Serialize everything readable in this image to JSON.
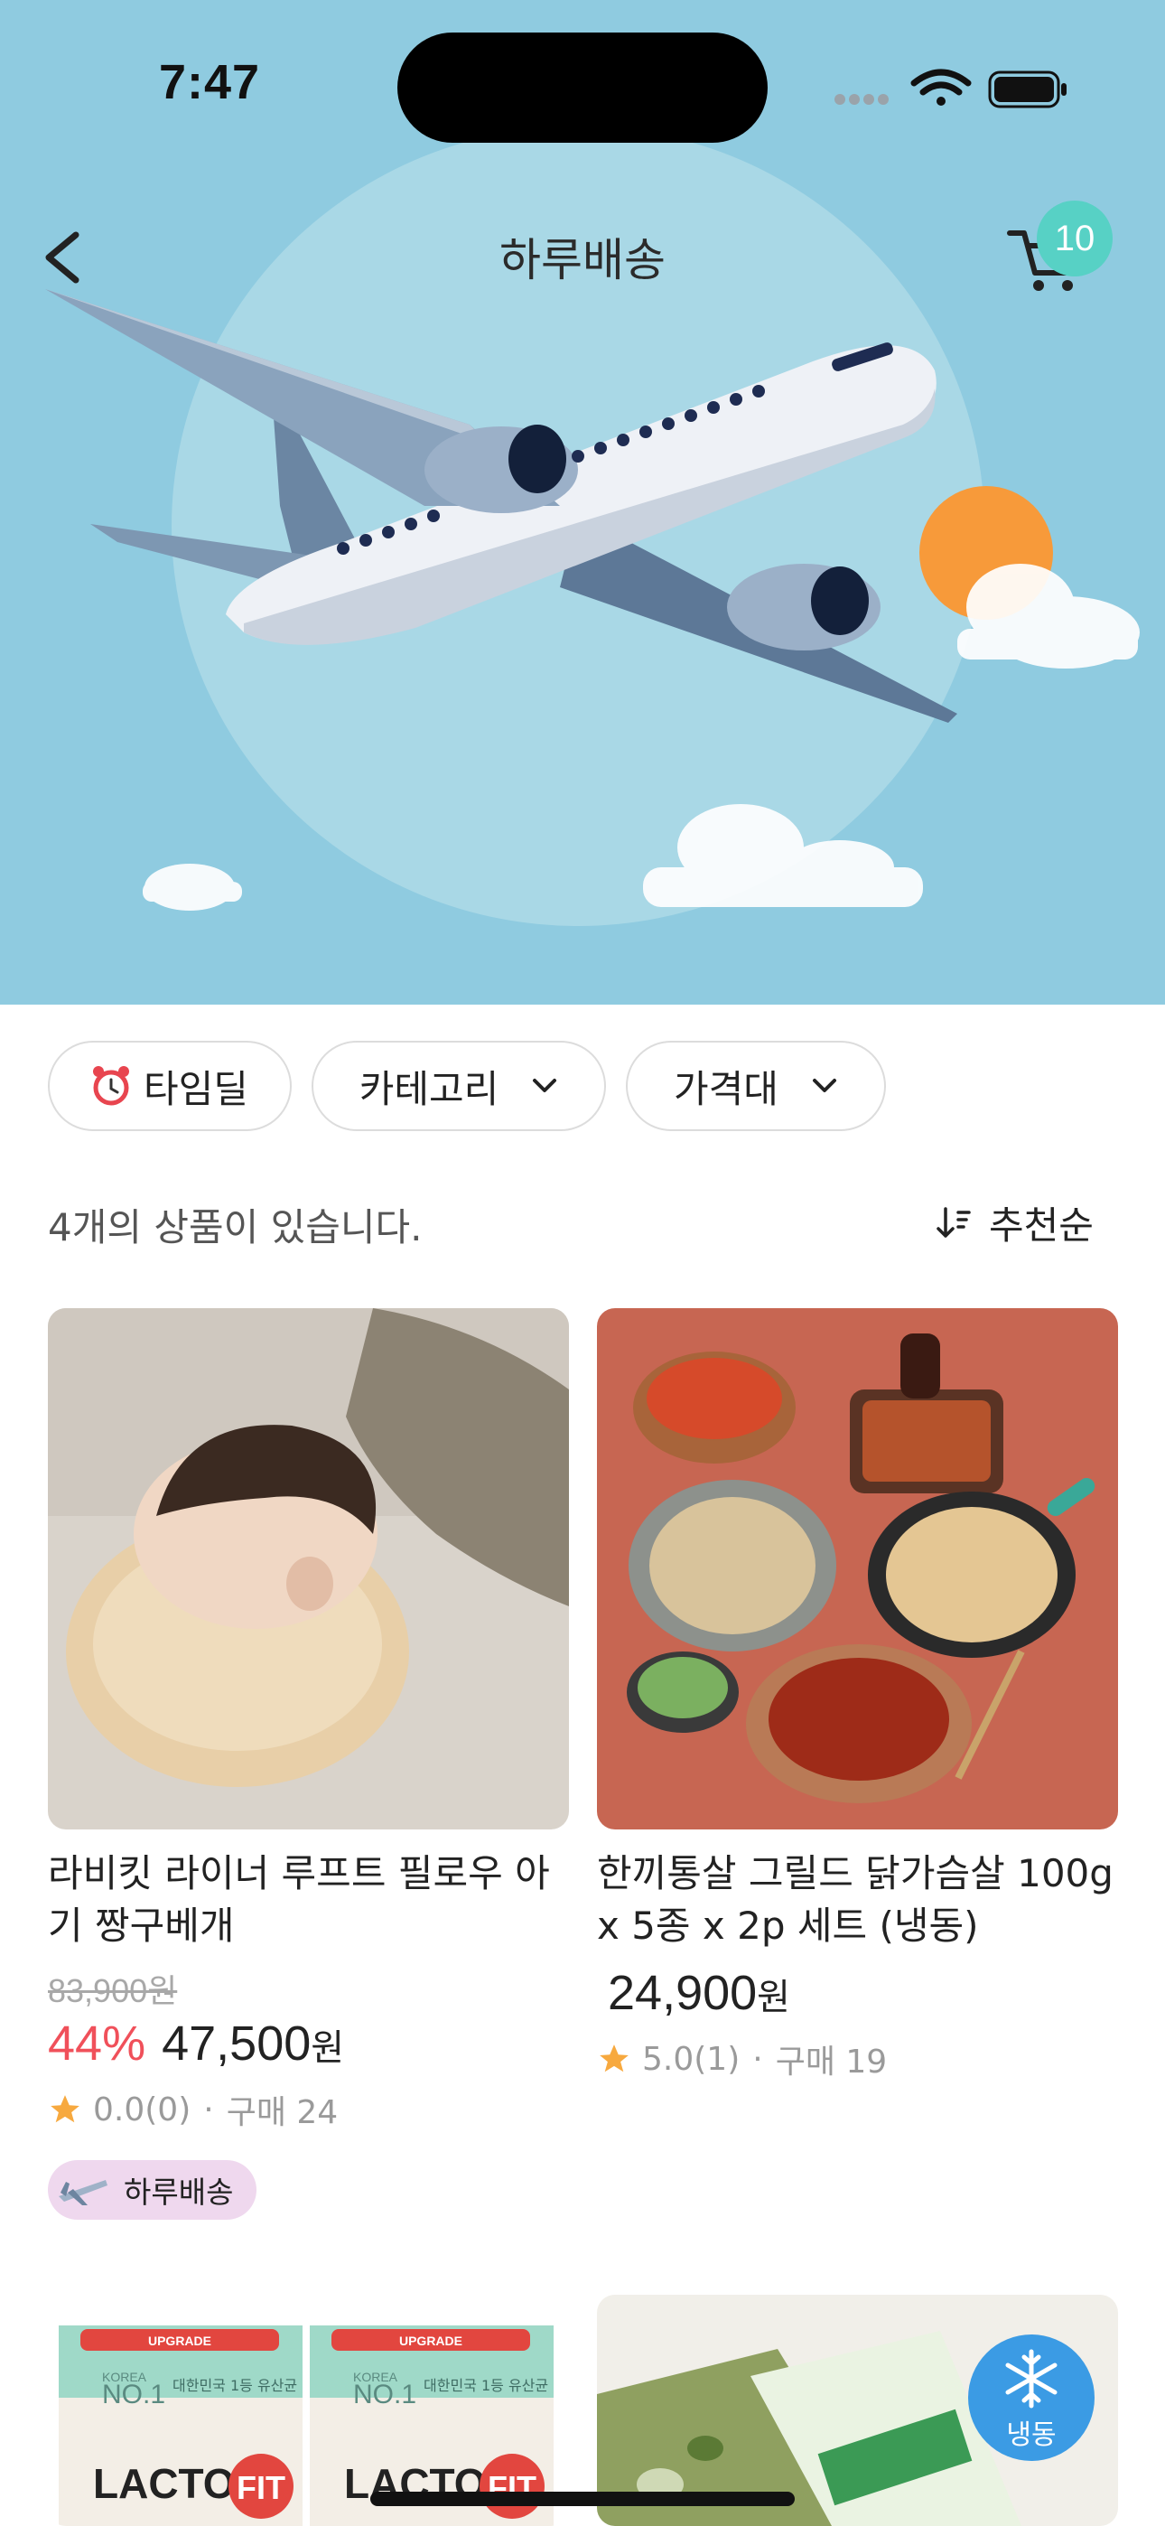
{
  "status_bar": {
    "time": "7:47"
  },
  "header": {
    "title": "하루배송",
    "cart_count": "10"
  },
  "filters": [
    {
      "label": "타임딜",
      "icon": "alarm-clock-icon",
      "dropdown": false
    },
    {
      "label": "카테고리",
      "dropdown": true
    },
    {
      "label": "가격대",
      "dropdown": true
    }
  ],
  "results": {
    "count_text": "4개의 상품이 있습니다.",
    "sort_label": "추천순"
  },
  "products": [
    {
      "title": "라비킷 라이너 루프트 필로우 아기 짱구베개",
      "original_price": "83,900원",
      "discount": "44%",
      "price": "47,500",
      "currency": "원",
      "rating": "0.0(0)",
      "purchases": "구매 24",
      "tag": "하루배송"
    },
    {
      "title": "한끼통살 그릴드 닭가슴살 100g x 5종 x 2p 세트 (냉동)",
      "price": "24,900",
      "currency": "원",
      "rating": "5.0(1)",
      "purchases": "구매 19"
    },
    {
      "title": "",
      "image_text": {
        "badge": "UPGRADE",
        "korea": "KOREA",
        "no1": "NO.1",
        "desc": "대한민국 1등 유산균",
        "brand": "LACTO",
        "brand_fit": "FIT"
      }
    },
    {
      "title": "",
      "freeze_label": "냉동"
    }
  ],
  "colors": {
    "hero_bg": "#8fcbe0",
    "discount": "#f0505a",
    "cart_badge": "#57d1c5",
    "freeze_badge": "#3b9be4",
    "tag_bg": "#efd8ee"
  }
}
